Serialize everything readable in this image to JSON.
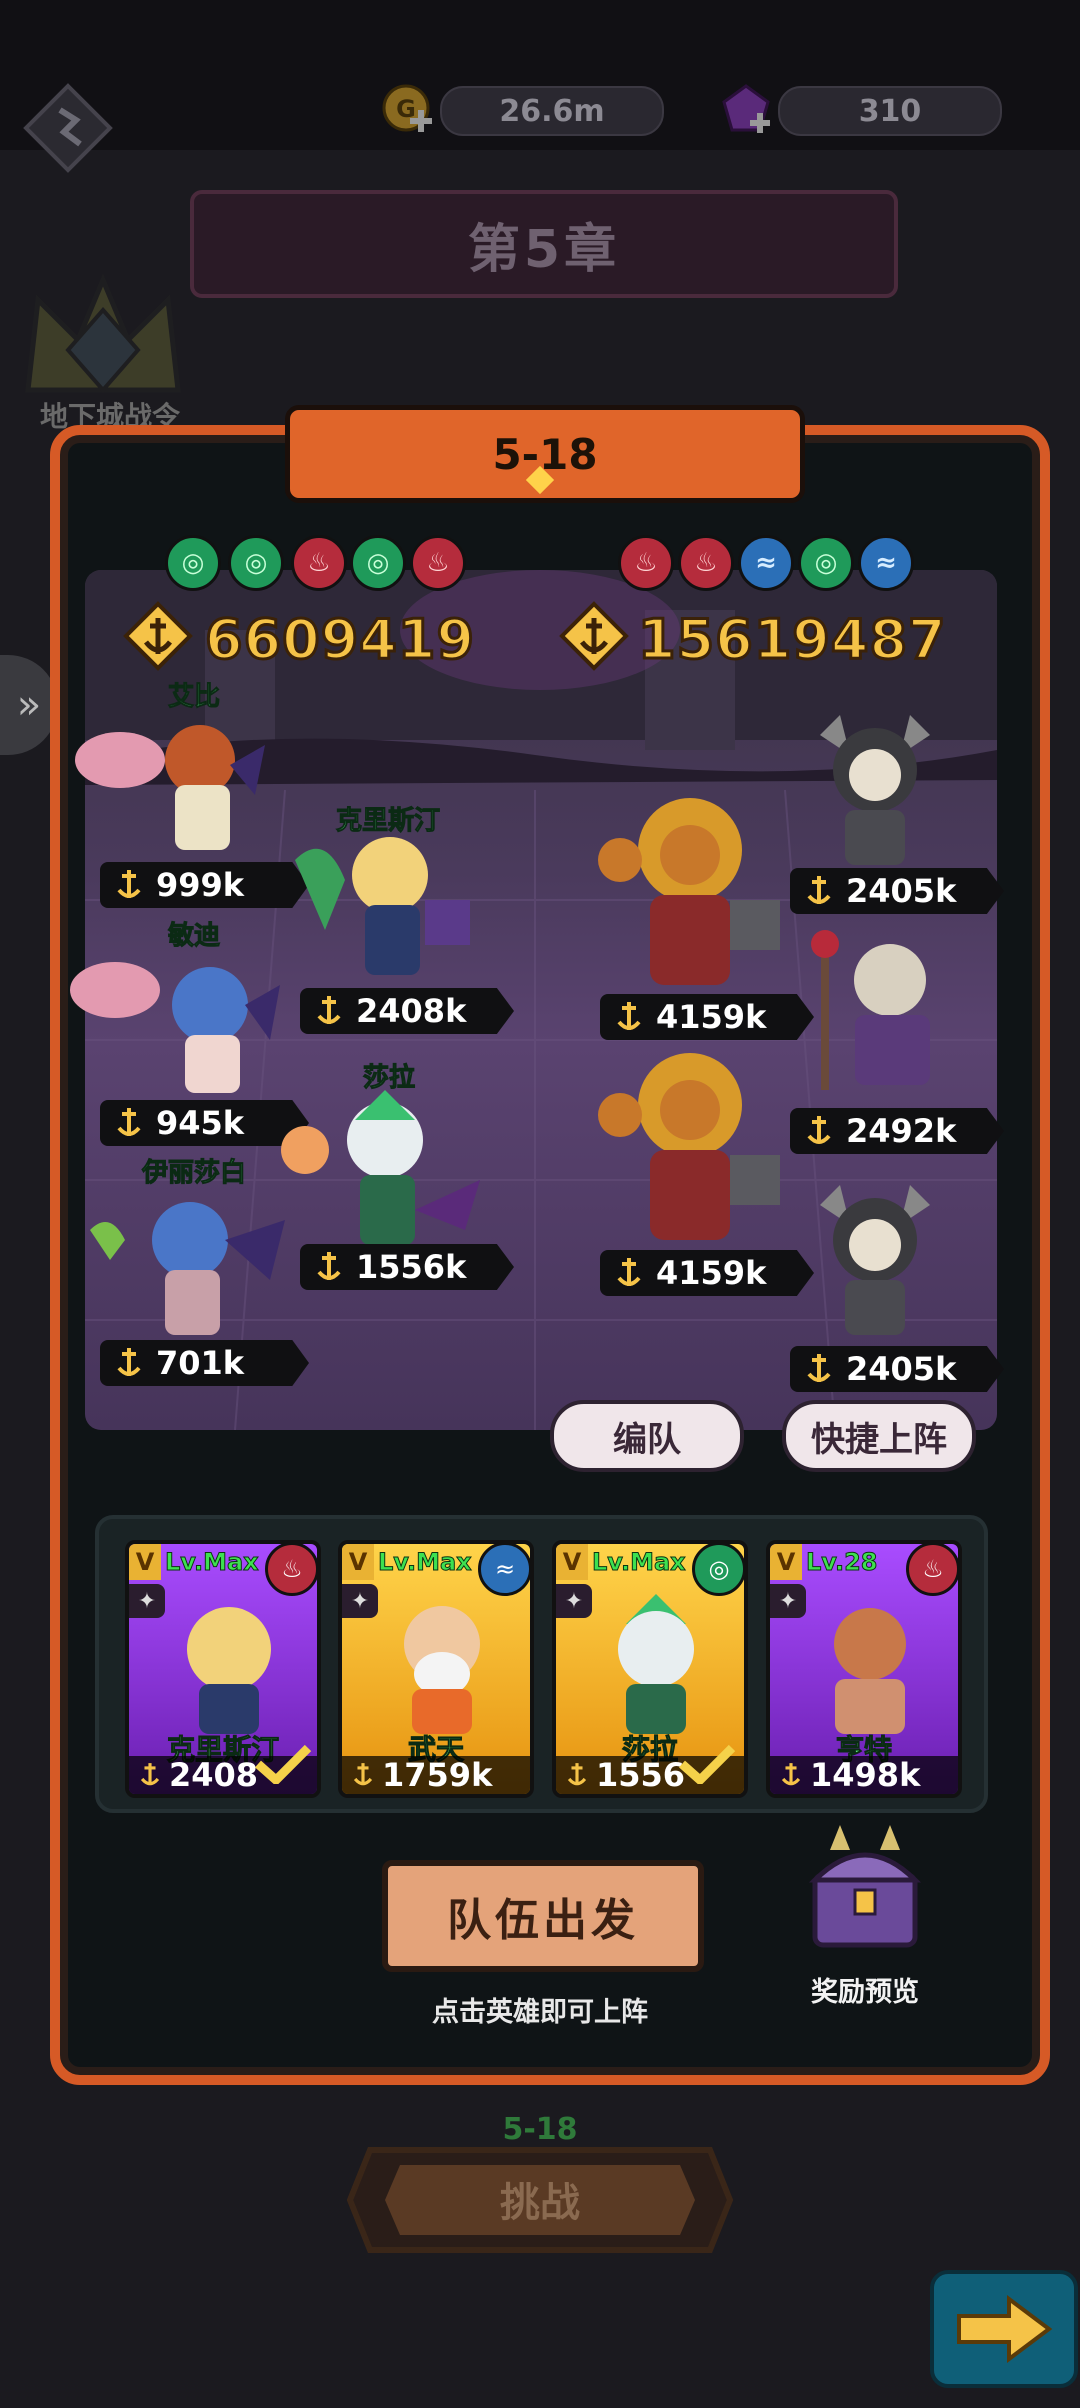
{
  "resources": {
    "gold": "26.6m",
    "gems": "310"
  },
  "chapter": {
    "title": "第5章",
    "side_label": "地下城战令"
  },
  "stage": {
    "label": "5-18"
  },
  "teams": {
    "player": {
      "power": "6609419",
      "elements": [
        "wind",
        "wind",
        "fire",
        "wind",
        "fire"
      ]
    },
    "enemy": {
      "power": "15619487",
      "elements": [
        "fire",
        "fire",
        "water",
        "wind",
        "water"
      ]
    }
  },
  "player_units": [
    {
      "name": "艾比",
      "power": "999k"
    },
    {
      "name": "克里斯汀",
      "power": "2408k"
    },
    {
      "name": "敏迪",
      "power": "945k"
    },
    {
      "name": "莎拉",
      "power": "1556k"
    },
    {
      "name": "伊丽莎白",
      "power": "701k"
    }
  ],
  "enemy_units": [
    {
      "power": "2405k"
    },
    {
      "power": "4159k"
    },
    {
      "power": "2492k"
    },
    {
      "power": "4159k"
    },
    {
      "power": "2405k"
    }
  ],
  "buttons": {
    "formation": "编队",
    "quick_deploy": "快捷上阵",
    "go": "队伍出发",
    "reward": "奖励预览",
    "challenge": "挑战"
  },
  "hint": "点击英雄即可上阵",
  "challenge_stage": "5-18",
  "roster": [
    {
      "level": "Lv.Max",
      "name": "克里斯汀",
      "power": "2408",
      "element": "fire",
      "selected": true
    },
    {
      "level": "Lv.Max",
      "name": "武天",
      "power": "1759k",
      "element": "water",
      "selected": false
    },
    {
      "level": "Lv.Max",
      "name": "莎拉",
      "power": "1556",
      "element": "wind",
      "selected": true
    },
    {
      "level": "Lv.28",
      "name": "亨特",
      "power": "1498k",
      "element": "fire",
      "selected": false
    }
  ],
  "colors": {
    "accent": "#d65a26",
    "power": "#f5c348",
    "name_green": "#50e07a"
  }
}
